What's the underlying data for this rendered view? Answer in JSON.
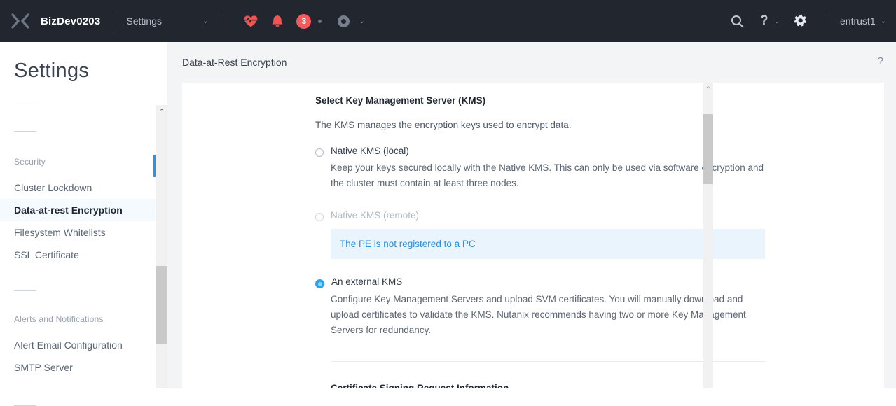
{
  "topbar": {
    "logo": "x-logo-icon",
    "cluster_name": "BizDev0203",
    "nav_label": "Settings",
    "nav_chevron": "⌄",
    "icons": {
      "health": "heart-pulse-icon",
      "bell": "bell-icon",
      "badge_count": "3",
      "task_dot": "dot-icon",
      "ring": "circle-ring-icon",
      "ring_chevron": "⌄",
      "search": "search-icon",
      "help": "?",
      "help_chevron": "⌄",
      "gear": "gear-icon"
    },
    "user_name": "entrust1",
    "user_chevron": "⌄"
  },
  "sidebar": {
    "title": "Settings",
    "sections": [
      {
        "label": "Security",
        "items": [
          {
            "label": "Cluster Lockdown",
            "active": false
          },
          {
            "label": "Data-at-rest Encryption",
            "active": true
          },
          {
            "label": "Filesystem Whitelists",
            "active": false
          },
          {
            "label": "SSL Certificate",
            "active": false
          }
        ]
      },
      {
        "label": "Alerts and Notifications",
        "items": [
          {
            "label": "Alert Email Configuration",
            "active": false
          },
          {
            "label": "SMTP Server",
            "active": false
          }
        ]
      }
    ],
    "scroll_arrow": "⌃"
  },
  "main": {
    "breadcrumb": "Data-at-Rest Encryption",
    "help_icon": "?",
    "scroll_arrow": "⌃",
    "section_title": "Select Key Management Server (KMS)",
    "section_lead": "The KMS manages the encryption keys used to encrypt data.",
    "options": [
      {
        "label": "Native KMS (local)",
        "description": "Keep your keys secured locally with the Native KMS. This can only be used via software encryption and the cluster must contain at least three nodes.",
        "selected": false,
        "disabled": false
      },
      {
        "label": "Native KMS (remote)",
        "description": "",
        "selected": false,
        "disabled": true,
        "info_message": "The PE is not registered to a PC"
      },
      {
        "label": "An external KMS",
        "description": "Configure Key Management Servers and upload SVM certificates. You will manually download and upload certificates to validate the KMS. Nutanix recommends having two or more Key Management Servers for redundancy.",
        "selected": true,
        "disabled": false
      }
    ],
    "csr_title": "Certificate Signing Request Information"
  },
  "colors": {
    "topbar_bg": "#22262e",
    "accent_blue": "#2196f3",
    "radio_blue": "#27a5e8",
    "info_bg": "#e9f4fc",
    "info_text": "#2a8edb",
    "alert_red": "#f25b5b",
    "active_item_bg": "#f4fafe",
    "page_bg": "#f3f4f6"
  }
}
